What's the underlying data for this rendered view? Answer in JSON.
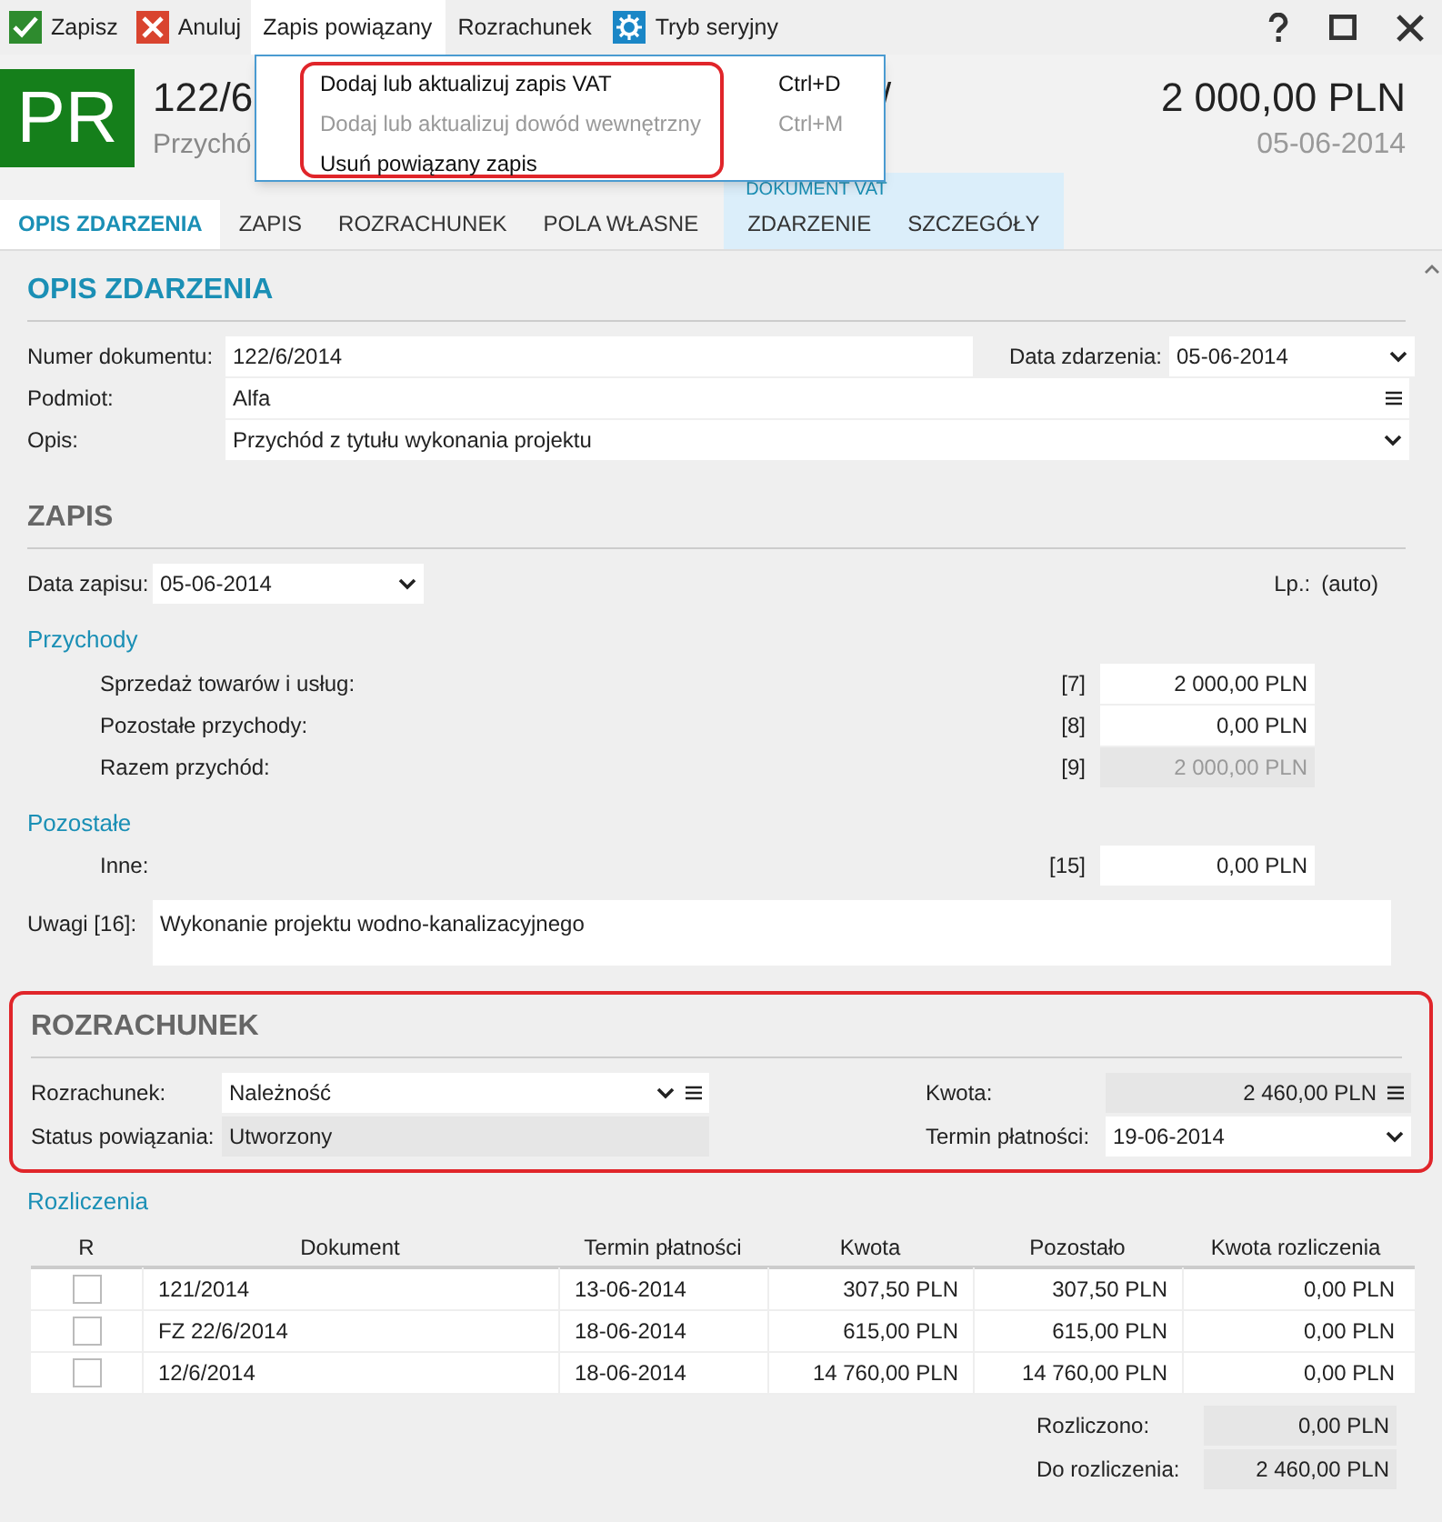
{
  "toolbar": [
    {
      "label": "Zapisz",
      "kind": "accept",
      "selected": false
    },
    {
      "label": "Anuluj",
      "kind": "cancel",
      "selected": false
    },
    {
      "label": "Zapis powiązany",
      "kind": "plain",
      "selected": true
    },
    {
      "label": "Rozrachunek",
      "kind": "plain",
      "selected": false
    },
    {
      "label": "Tryb seryjny",
      "kind": "settings",
      "selected": false
    }
  ],
  "header": {
    "badge": "PR",
    "title": "122/6",
    "title_tail": "/",
    "subtitle": "Przychó",
    "amount": "2 000,00 PLN",
    "date": "05-06-2014"
  },
  "menu": {
    "items": [
      {
        "label": "Dodaj lub aktualizuj zapis VAT",
        "shortcut": "Ctrl+D",
        "disabled": false
      },
      {
        "label": "Dodaj lub aktualizuj dowód wewnętrzny",
        "shortcut": "Ctrl+M",
        "disabled": true
      },
      {
        "label": "Usuń powiązany zapis",
        "disabled": false
      }
    ]
  },
  "tabs": [
    {
      "label": "OPIS ZDARZENIA",
      "selected": true
    },
    {
      "label": "ZAPIS",
      "selected": false
    },
    {
      "label": "ROZRACHUNEK",
      "selected": false
    },
    {
      "label": "POLA WŁASNE",
      "selected": false
    }
  ],
  "tab_group": {
    "label": "DOKUMENT VAT",
    "tabs": [
      {
        "label": "ZDARZENIE",
        "selected": false
      },
      {
        "label": "SZCZEGÓŁY",
        "selected": false
      }
    ]
  },
  "opis": {
    "heading": "OPIS ZDARZENIA",
    "numer": {
      "label": "Numer dokumentu:",
      "value": "122/6/2014"
    },
    "data": {
      "label": "Data zdarzenia:",
      "value": "05-06-2014"
    },
    "podmiot": {
      "label": "Podmiot:",
      "value": "Alfa"
    },
    "opis": {
      "label": "Opis:",
      "value": "Przychód z tytułu wykonania projektu"
    }
  },
  "zapis": {
    "heading": "ZAPIS",
    "data_zapisu": {
      "label": "Data zapisu:",
      "value": "05-06-2014"
    },
    "lp": {
      "label": "Lp.:",
      "value": "(auto)"
    },
    "groups": [
      {
        "heading": "Przychody",
        "rows": [
          {
            "label": "Sprzedaż towarów i usług:",
            "code": "[7]",
            "value": "2 000,00 PLN",
            "readonly": false
          },
          {
            "label": "Pozostałe przychody:",
            "code": "[8]",
            "value": "0,00 PLN",
            "readonly": false
          },
          {
            "label": "Razem przychód:",
            "code": "[9]",
            "value": "2 000,00 PLN",
            "readonly": true
          }
        ]
      },
      {
        "heading": "Pozostałe",
        "rows": [
          {
            "label": "Inne:",
            "code": "[15]",
            "value": "0,00 PLN",
            "readonly": false
          }
        ]
      }
    ],
    "uwagi": {
      "label": "Uwagi [16]:",
      "value": "Wykonanie projektu wodno-kanalizacyjnego"
    }
  },
  "rozrachunek": {
    "heading": "ROZRACHUNEK",
    "rozrachunek": {
      "label": "Rozrachunek:",
      "value": "Należność"
    },
    "status": {
      "label": "Status powiązania:",
      "value": "Utworzony"
    },
    "kwota": {
      "label": "Kwota:",
      "value": "2 460,00 PLN"
    },
    "termin": {
      "label": "Termin płatności:",
      "value": "19-06-2014"
    }
  },
  "rozliczenia": {
    "heading": "Rozliczenia",
    "check_column": "R",
    "columns": [
      "Dokument",
      "Termin płatności",
      "Kwota",
      "Pozostało",
      "Kwota rozliczenia"
    ],
    "rows": [
      {
        "checked": false,
        "cells": [
          "121/2014",
          "13-06-2014",
          "307,50 PLN",
          "307,50 PLN",
          "0,00 PLN"
        ]
      },
      {
        "checked": false,
        "cells": [
          "FZ 22/6/2014",
          "18-06-2014",
          "615,00 PLN",
          "615,00 PLN",
          "0,00 PLN"
        ]
      },
      {
        "checked": false,
        "cells": [
          "12/6/2014",
          "18-06-2014",
          "14 760,00 PLN",
          "14 760,00 PLN",
          "0,00 PLN"
        ]
      }
    ],
    "summary": [
      {
        "label": "Rozliczono:",
        "value": "0,00 PLN"
      },
      {
        "label": "Do rozliczenia:",
        "value": "2 460,00 PLN"
      }
    ]
  }
}
